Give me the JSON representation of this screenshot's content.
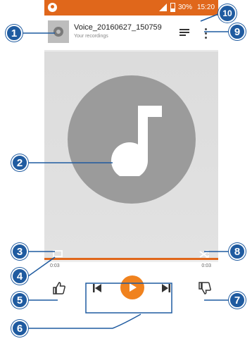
{
  "status_bar": {
    "battery": "30%",
    "time": "15:20",
    "accent": "#e0671b"
  },
  "header": {
    "title": "Voice_20160627_150759",
    "subtitle": "Your recordings",
    "icons": [
      "album-thumb-icon",
      "queue-icon",
      "more-vert-icon"
    ]
  },
  "player": {
    "current_time": "0:03",
    "total_time": "0:03",
    "progress": 1.0,
    "icons": [
      "music-note-icon",
      "repeat-icon",
      "shuffle-icon",
      "thumbs-up-icon",
      "skip-previous-icon",
      "play-icon",
      "skip-next-icon",
      "thumbs-down-icon"
    ],
    "play_color": "#f0821e"
  },
  "callouts": {
    "c1": "1",
    "c2": "2",
    "c3": "3",
    "c4": "4",
    "c5": "5",
    "c6": "6",
    "c7": "7",
    "c8": "8",
    "c9": "9",
    "c10": "10",
    "color": "#1f5ba0"
  }
}
